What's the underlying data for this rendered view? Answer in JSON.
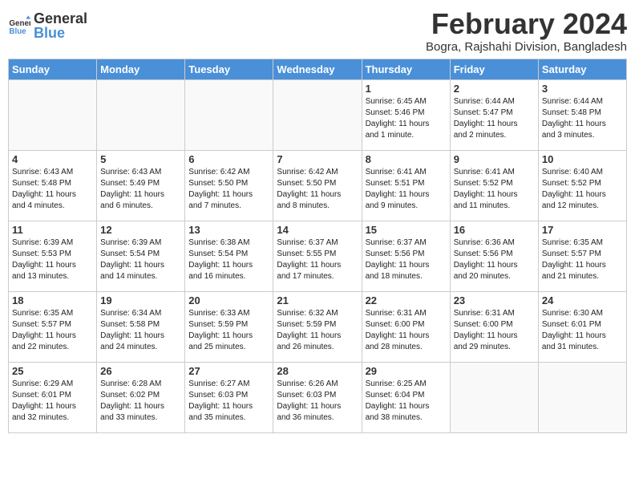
{
  "logo": {
    "general": "General",
    "blue": "Blue"
  },
  "title": "February 2024",
  "subtitle": "Bogra, Rajshahi Division, Bangladesh",
  "days_of_week": [
    "Sunday",
    "Monday",
    "Tuesday",
    "Wednesday",
    "Thursday",
    "Friday",
    "Saturday"
  ],
  "weeks": [
    [
      {
        "day": "",
        "info": ""
      },
      {
        "day": "",
        "info": ""
      },
      {
        "day": "",
        "info": ""
      },
      {
        "day": "",
        "info": ""
      },
      {
        "day": "1",
        "info": "Sunrise: 6:45 AM\nSunset: 5:46 PM\nDaylight: 11 hours\nand 1 minute."
      },
      {
        "day": "2",
        "info": "Sunrise: 6:44 AM\nSunset: 5:47 PM\nDaylight: 11 hours\nand 2 minutes."
      },
      {
        "day": "3",
        "info": "Sunrise: 6:44 AM\nSunset: 5:48 PM\nDaylight: 11 hours\nand 3 minutes."
      }
    ],
    [
      {
        "day": "4",
        "info": "Sunrise: 6:43 AM\nSunset: 5:48 PM\nDaylight: 11 hours\nand 4 minutes."
      },
      {
        "day": "5",
        "info": "Sunrise: 6:43 AM\nSunset: 5:49 PM\nDaylight: 11 hours\nand 6 minutes."
      },
      {
        "day": "6",
        "info": "Sunrise: 6:42 AM\nSunset: 5:50 PM\nDaylight: 11 hours\nand 7 minutes."
      },
      {
        "day": "7",
        "info": "Sunrise: 6:42 AM\nSunset: 5:50 PM\nDaylight: 11 hours\nand 8 minutes."
      },
      {
        "day": "8",
        "info": "Sunrise: 6:41 AM\nSunset: 5:51 PM\nDaylight: 11 hours\nand 9 minutes."
      },
      {
        "day": "9",
        "info": "Sunrise: 6:41 AM\nSunset: 5:52 PM\nDaylight: 11 hours\nand 11 minutes."
      },
      {
        "day": "10",
        "info": "Sunrise: 6:40 AM\nSunset: 5:52 PM\nDaylight: 11 hours\nand 12 minutes."
      }
    ],
    [
      {
        "day": "11",
        "info": "Sunrise: 6:39 AM\nSunset: 5:53 PM\nDaylight: 11 hours\nand 13 minutes."
      },
      {
        "day": "12",
        "info": "Sunrise: 6:39 AM\nSunset: 5:54 PM\nDaylight: 11 hours\nand 14 minutes."
      },
      {
        "day": "13",
        "info": "Sunrise: 6:38 AM\nSunset: 5:54 PM\nDaylight: 11 hours\nand 16 minutes."
      },
      {
        "day": "14",
        "info": "Sunrise: 6:37 AM\nSunset: 5:55 PM\nDaylight: 11 hours\nand 17 minutes."
      },
      {
        "day": "15",
        "info": "Sunrise: 6:37 AM\nSunset: 5:56 PM\nDaylight: 11 hours\nand 18 minutes."
      },
      {
        "day": "16",
        "info": "Sunrise: 6:36 AM\nSunset: 5:56 PM\nDaylight: 11 hours\nand 20 minutes."
      },
      {
        "day": "17",
        "info": "Sunrise: 6:35 AM\nSunset: 5:57 PM\nDaylight: 11 hours\nand 21 minutes."
      }
    ],
    [
      {
        "day": "18",
        "info": "Sunrise: 6:35 AM\nSunset: 5:57 PM\nDaylight: 11 hours\nand 22 minutes."
      },
      {
        "day": "19",
        "info": "Sunrise: 6:34 AM\nSunset: 5:58 PM\nDaylight: 11 hours\nand 24 minutes."
      },
      {
        "day": "20",
        "info": "Sunrise: 6:33 AM\nSunset: 5:59 PM\nDaylight: 11 hours\nand 25 minutes."
      },
      {
        "day": "21",
        "info": "Sunrise: 6:32 AM\nSunset: 5:59 PM\nDaylight: 11 hours\nand 26 minutes."
      },
      {
        "day": "22",
        "info": "Sunrise: 6:31 AM\nSunset: 6:00 PM\nDaylight: 11 hours\nand 28 minutes."
      },
      {
        "day": "23",
        "info": "Sunrise: 6:31 AM\nSunset: 6:00 PM\nDaylight: 11 hours\nand 29 minutes."
      },
      {
        "day": "24",
        "info": "Sunrise: 6:30 AM\nSunset: 6:01 PM\nDaylight: 11 hours\nand 31 minutes."
      }
    ],
    [
      {
        "day": "25",
        "info": "Sunrise: 6:29 AM\nSunset: 6:01 PM\nDaylight: 11 hours\nand 32 minutes."
      },
      {
        "day": "26",
        "info": "Sunrise: 6:28 AM\nSunset: 6:02 PM\nDaylight: 11 hours\nand 33 minutes."
      },
      {
        "day": "27",
        "info": "Sunrise: 6:27 AM\nSunset: 6:03 PM\nDaylight: 11 hours\nand 35 minutes."
      },
      {
        "day": "28",
        "info": "Sunrise: 6:26 AM\nSunset: 6:03 PM\nDaylight: 11 hours\nand 36 minutes."
      },
      {
        "day": "29",
        "info": "Sunrise: 6:25 AM\nSunset: 6:04 PM\nDaylight: 11 hours\nand 38 minutes."
      },
      {
        "day": "",
        "info": ""
      },
      {
        "day": "",
        "info": ""
      }
    ]
  ]
}
